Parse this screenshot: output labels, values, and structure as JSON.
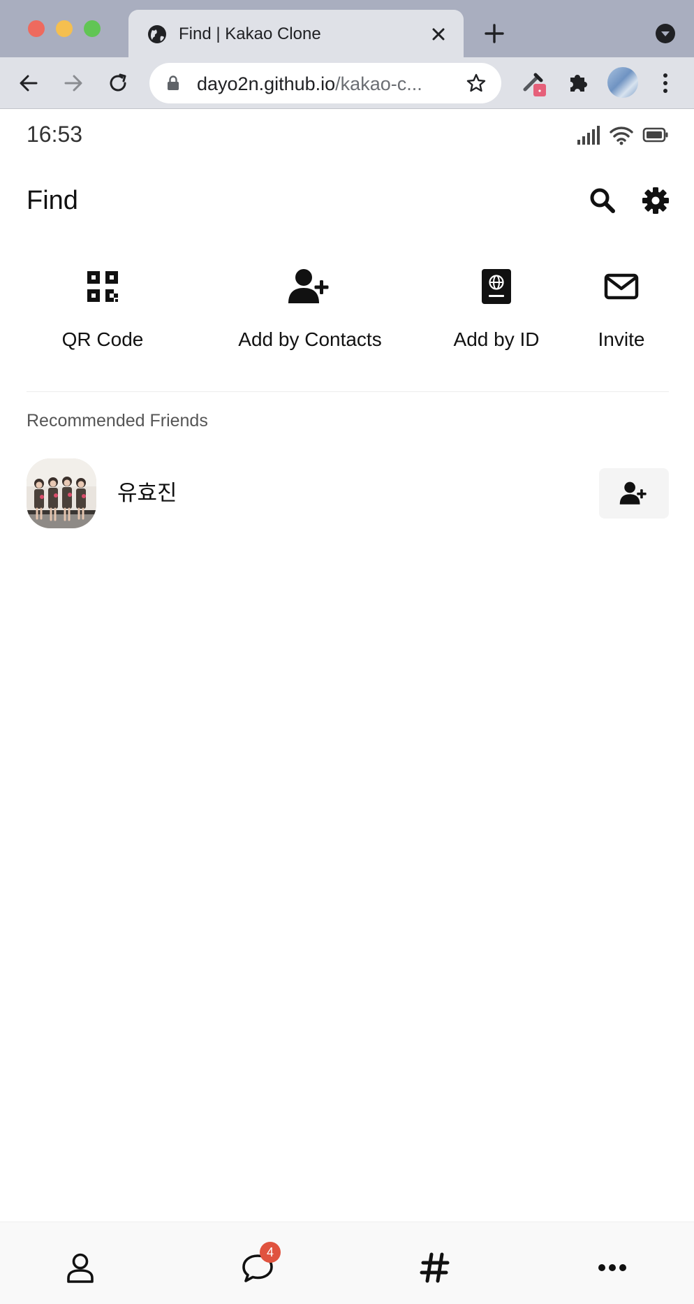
{
  "browser": {
    "tab": {
      "title": "Find | Kakao Clone"
    },
    "address_bar": {
      "host": "dayo2n.github.io",
      "path": "/kakao-c..."
    }
  },
  "status_bar": {
    "time": "16:53"
  },
  "header": {
    "title": "Find"
  },
  "actions": [
    {
      "label": "QR Code",
      "icon": "qr-code-icon"
    },
    {
      "label": "Add by Contacts",
      "icon": "user-plus-icon"
    },
    {
      "label": "Add by ID",
      "icon": "passport-icon"
    },
    {
      "label": "Invite",
      "icon": "envelope-icon"
    }
  ],
  "recommended": {
    "title": "Recommended Friends",
    "friends": [
      {
        "name": "유효진",
        "avatar": "group-photo"
      }
    ]
  },
  "tab_nav": {
    "items": [
      {
        "icon": "person-icon"
      },
      {
        "icon": "chat-bubble-icon",
        "badge": "4"
      },
      {
        "icon": "hashtag-icon"
      },
      {
        "icon": "ellipsis-icon"
      }
    ]
  },
  "colors": {
    "badge": "#e0533f",
    "tabbar_bg": "#a9aebf",
    "toolbar_bg": "#dfe1e7",
    "nav_bg": "#f9f9f9"
  }
}
